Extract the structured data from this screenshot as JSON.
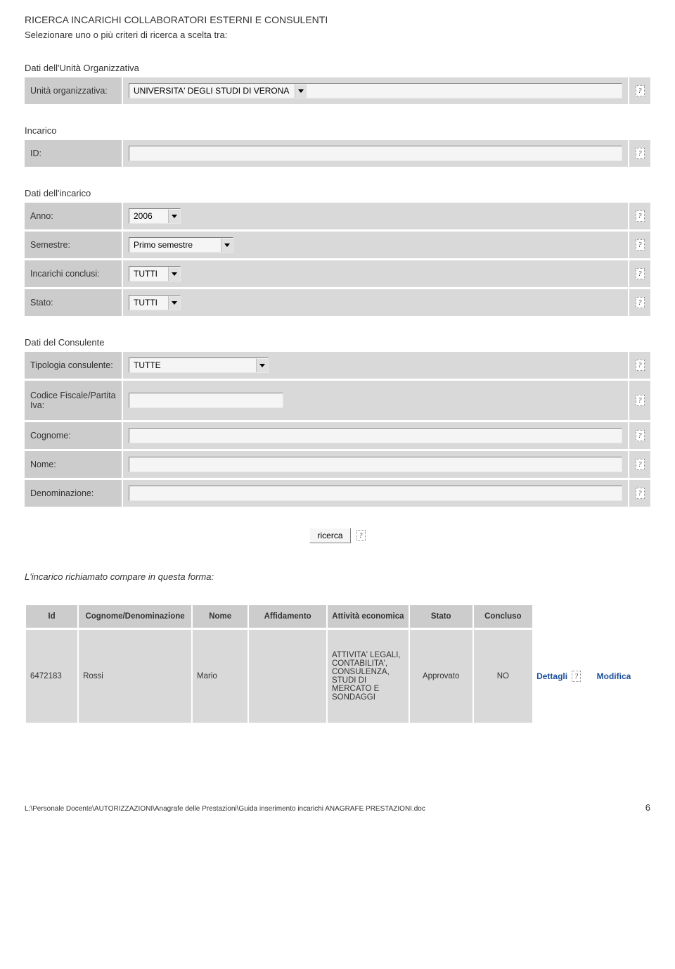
{
  "title": "RICERCA INCARICHI COLLABORATORI ESTERNI E CONSULENTI",
  "subtitle": "Selezionare uno o più criteri di ricerca a scelta tra:",
  "sections": {
    "unita_heading": "Dati dell'Unità Organizzativa",
    "incarico_heading": "Incarico",
    "dati_incarico_heading": "Dati dell'incarico",
    "dati_consulente_heading": "Dati del Consulente"
  },
  "labels": {
    "unita": "Unità organizzativa:",
    "id": "ID:",
    "anno": "Anno:",
    "semestre": "Semestre:",
    "incarichi_conclusi": "Incarichi conclusi:",
    "stato": "Stato:",
    "tipologia": "Tipologia consulente:",
    "cf": "Codice Fiscale/Partita Iva:",
    "cognome": "Cognome:",
    "nome": "Nome:",
    "denominazione": "Denominazione:"
  },
  "values": {
    "unita": "UNIVERSITA' DEGLI STUDI DI VERONA",
    "id": "",
    "anno": "2006",
    "semestre": "Primo semestre",
    "incarichi_conclusi": "TUTTI",
    "stato": "TUTTI",
    "tipologia": "TUTTE",
    "cf": "",
    "cognome": "",
    "nome": "",
    "denominazione": ""
  },
  "search_button": "ricerca",
  "result_intro": "L'incarico richiamato compare in questa forma:",
  "result_headers": [
    "Id",
    "Cognome/Denominazione",
    "Nome",
    "Affidamento",
    "Attività economica",
    "Stato",
    "Concluso"
  ],
  "result_row": {
    "id": "6472183",
    "cognome": "Rossi",
    "nome": "Mario",
    "affidamento": "",
    "attivita": "ATTIVITA' LEGALI, CONTABILITA', CONSULENZA, STUDI DI MERCATO E SONDAGGI",
    "stato": "Approvato",
    "concluso": "NO"
  },
  "link_dettagli": "Dettagli",
  "link_modifica": "Modifica",
  "footer_path": "L:\\Personale Docente\\AUTORIZZAZIONI\\Anagrafe delle Prestazioni\\Guida inserimento incarichi ANAGRAFE PRESTAZIONI.doc",
  "page_number": "6"
}
